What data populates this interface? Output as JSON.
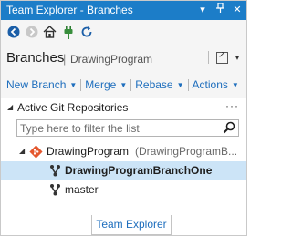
{
  "window": {
    "title": "Team Explorer - Branches",
    "title_icons": [
      "dropdown-icon",
      "pin-icon",
      "close-icon"
    ]
  },
  "toolbar": {
    "buttons": [
      "back-icon",
      "forward-icon",
      "home-icon",
      "connect-plug-icon",
      "refresh-icon"
    ]
  },
  "header": {
    "title": "Branches",
    "separator": "|",
    "context": "DrawingProgram"
  },
  "actions": [
    {
      "label": "New Branch"
    },
    {
      "label": "Merge"
    },
    {
      "label": "Rebase"
    },
    {
      "label": "Actions"
    }
  ],
  "section": {
    "title": "Active Git Repositories",
    "more": "···"
  },
  "filter": {
    "placeholder": "Type here to filter the list",
    "value": ""
  },
  "tree": {
    "repo": {
      "name": "DrawingProgram",
      "path": "(DrawingProgramB..."
    },
    "branches": [
      {
        "name": "DrawingProgramBranchOne",
        "current": true,
        "selected": true
      },
      {
        "name": "master",
        "current": false,
        "selected": false
      }
    ]
  },
  "bottom_tab": {
    "label": "Team Explorer"
  },
  "colors": {
    "titlebar": "#1c7dc8",
    "link": "#1e6ebd",
    "selection": "#cce4f7",
    "git_orange": "#e4572e"
  }
}
